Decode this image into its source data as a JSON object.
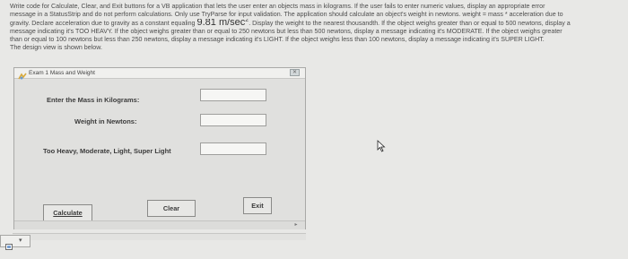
{
  "instructions": {
    "line1": "Write code for Calculate, Clear, and Exit buttons for a VB application that lets the user enter an objects mass in kilograms. If the user fails to enter numeric values, display an appropriate error",
    "line2": "message in a StatusStrip and do not perform calculations. Only use TryParse for input validation. The application should calculate an object's weight in newtons. weight = mass * acceleration due to",
    "line3": "gravity. Declare acceleration due to gravity as a constant equaling",
    "line3_value": "9.81 m/sec",
    "line3_exponent": "2",
    "line3_end": ". Display the weight to the nearest thousandth. If the object weighs greater than or equal to 500 newtons, display a",
    "line4": "message indicating it's TOO HEAVY. If the object weighs greater than or equal to 250 newtons but less than 500 newtons, display a message indicating it's MODERATE. If the object weighs greater",
    "line5": "than or equal to 100 newtons but less than 250 newtons, display a message indicating it's LIGHT. If the object weighs less than 100 newtons, display a message indicating it's SUPER LIGHT.",
    "line6": "The design view is shown below."
  },
  "form": {
    "title": "Exam 1 Mass and Weight",
    "close_label": "✕",
    "mass_label": "Enter the Mass in Kilograms:",
    "weight_label": "Weight in Newtons:",
    "status_label": "Too Heavy, Moderate, Light, Super Light",
    "mass_value": "",
    "weight_value": "",
    "status_value": "",
    "calculate_label": "Calculate",
    "clear_label": "Clear",
    "exit_label": "Exit"
  },
  "icons": {
    "app": "form-app-icon",
    "dropdown": "component-dropdown-icon",
    "cursor": "mouse-pointer-icon"
  },
  "colors": {
    "background": "#e8e8e6",
    "form_background": "#e0e0de",
    "textbox": "#f6f6f4"
  }
}
